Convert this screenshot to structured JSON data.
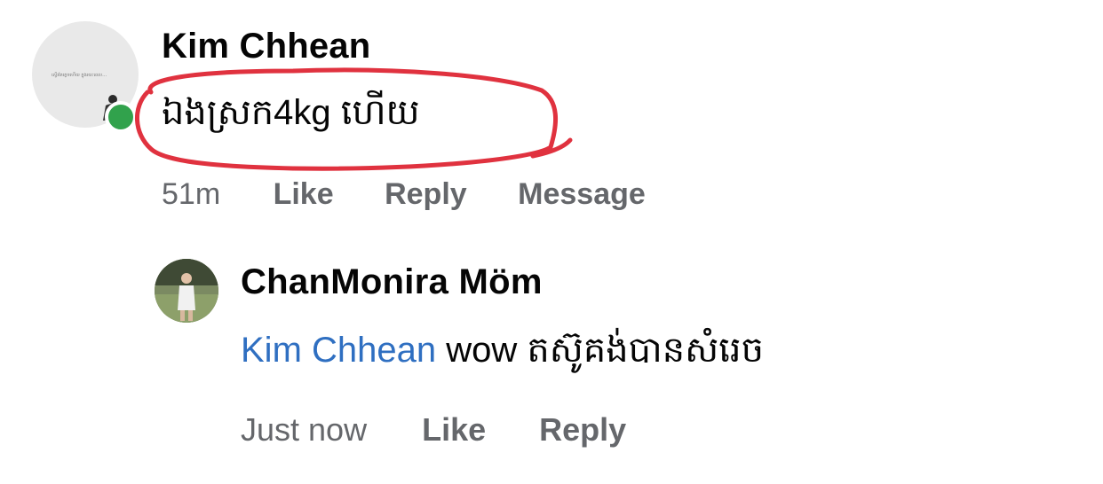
{
  "comment": {
    "author": "Kim Chhean",
    "text": "ឯងស្រក4kg ហើយ",
    "time": "51m",
    "actions": {
      "like": "Like",
      "reply": "Reply",
      "message": "Message"
    },
    "online": true,
    "highlight_color": "#e0323f"
  },
  "reply": {
    "author": "ChanMonira Möm",
    "mention": "Kim Chhean",
    "text": " wow តស៊ូគង់បានសំរេច",
    "time": "Just now",
    "actions": {
      "like": "Like",
      "reply": "Reply"
    }
  },
  "colors": {
    "meta_text": "#65676b",
    "mention": "#2f6fc1",
    "online": "#31a24c"
  }
}
